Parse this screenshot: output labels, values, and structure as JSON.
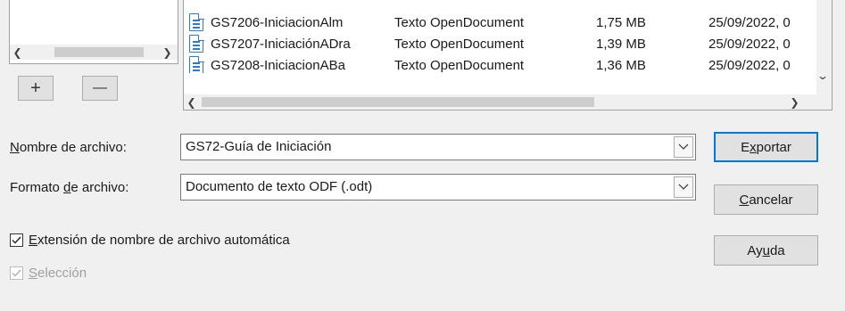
{
  "places_panel": {
    "add_label": "+",
    "remove_label": "—"
  },
  "file_list": {
    "rows": [
      {
        "name": "GS7206-IniciacionAlm",
        "type": "Texto OpenDocument",
        "size": "1,75 MB",
        "date": "25/09/2022, 0"
      },
      {
        "name": "GS7207-IniciaciónADra",
        "type": "Texto OpenDocument",
        "size": "1,39 MB",
        "date": "25/09/2022, 0"
      },
      {
        "name": "GS7208-IniciacionABa",
        "type": "Texto OpenDocument",
        "size": "1,36 MB",
        "date": "25/09/2022, 0"
      }
    ]
  },
  "form": {
    "filename_label_prefix": "N",
    "filename_label_rest": "ombre de archivo:",
    "filename_value": "GS72-Guía de Iniciación",
    "format_label_prefix": "Formato ",
    "format_label_ul": "d",
    "format_label_rest": "e archivo:",
    "format_value": "Documento de texto ODF (.odt)"
  },
  "buttons": {
    "export_pre": "E",
    "export_ul": "x",
    "export_post": "portar",
    "cancel_ul": "C",
    "cancel_post": "ancelar",
    "help_pre": "Ay",
    "help_ul": "u",
    "help_post": "da"
  },
  "options": {
    "auto_ext_ul": "E",
    "auto_ext_rest": "xtensión de nombre de archivo automática",
    "auto_ext_checked": true,
    "selection_ul": "S",
    "selection_rest": "elección",
    "selection_checked": true,
    "selection_enabled": false
  },
  "colors": {
    "accent": "#0078d7",
    "file_icon": "#2b7bd3"
  }
}
